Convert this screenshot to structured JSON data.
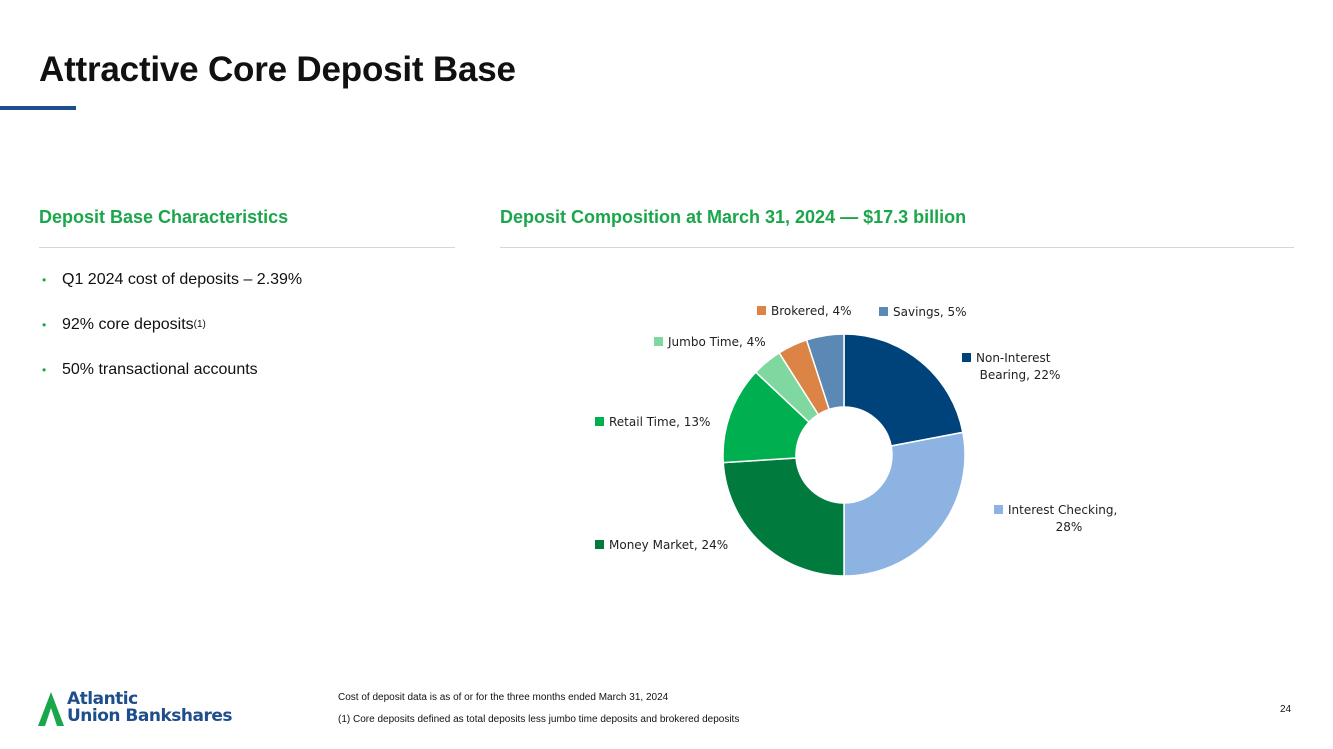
{
  "page": {
    "title": "Attractive Core Deposit Base",
    "page_number": "24"
  },
  "left_section": {
    "heading": "Deposit Base Characteristics",
    "bullets": [
      {
        "text": "Q1 2024 cost of deposits – 2.39%",
        "sup": ""
      },
      {
        "text": "92% core deposits",
        "sup": "(1)"
      },
      {
        "text": "50% transactional accounts",
        "sup": ""
      }
    ]
  },
  "right_section": {
    "heading": "Deposit Composition at March 31, 2024 — $17.3 billion"
  },
  "chart_data": {
    "type": "pie",
    "donut": true,
    "title": "Deposit Composition at March 31, 2024 — $17.3 billion",
    "slices": [
      {
        "name": "Non-Interest Bearing",
        "value": 22,
        "label_lines": [
          "Non-Interest",
          "Bearing, 22%"
        ],
        "color": "#00427a"
      },
      {
        "name": "Interest Checking",
        "value": 28,
        "label_lines": [
          "Interest Checking,",
          "28%"
        ],
        "color": "#8db3e2"
      },
      {
        "name": "Money Market",
        "value": 24,
        "label_lines": [
          "Money Market, 24%"
        ],
        "color": "#007a3d"
      },
      {
        "name": "Retail Time",
        "value": 13,
        "label_lines": [
          "Retail Time, 13%"
        ],
        "color": "#00b050"
      },
      {
        "name": "Jumbo Time",
        "value": 4,
        "label_lines": [
          "Jumbo Time, 4%"
        ],
        "color": "#7fd89f"
      },
      {
        "name": "Brokered",
        "value": 4,
        "label_lines": [
          "Brokered, 4%"
        ],
        "color": "#dc8446"
      },
      {
        "name": "Savings",
        "value": 5,
        "label_lines": [
          "Savings, 5%"
        ],
        "color": "#5b88b5"
      }
    ]
  },
  "footnotes": [
    "Cost of deposit data is as of or for the three months ended March 31, 2024",
    "(1) Core deposits defined as total deposits less jumbo time deposits and brokered deposits"
  ],
  "logo": {
    "line1": "Atlantic",
    "line2": "Union Bankshares"
  }
}
